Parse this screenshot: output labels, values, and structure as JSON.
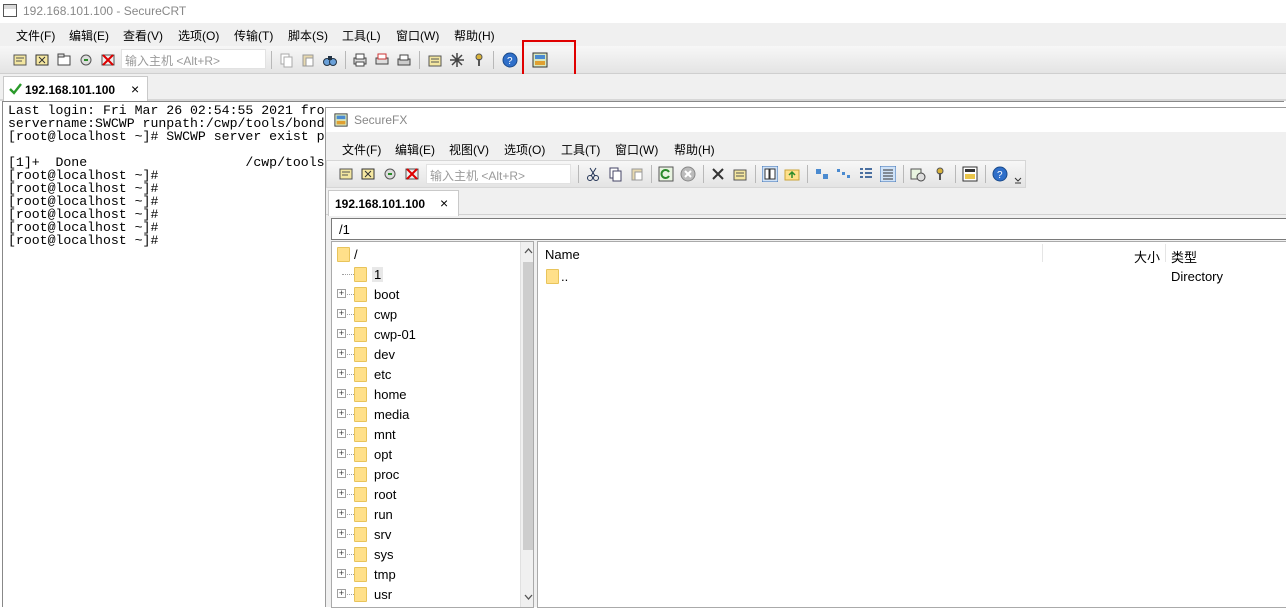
{
  "crt": {
    "title": "192.168.101.100 - SecureCRT",
    "menu": [
      "文件(F)",
      "编辑(E)",
      "查看(V)",
      "选项(O)",
      "传输(T)",
      "脚本(S)",
      "工具(L)",
      "窗口(W)",
      "帮助(H)"
    ],
    "host_placeholder": "输入主机 <Alt+R>",
    "tab_label": "192.168.101.100",
    "tab_close": "×",
    "terminal_lines": [
      "Last login: Fri Mar 26 02:54:55 2021 fro",
      "servername:SWCWP runpath:/cwp/tools/bond",
      "[root@localhost ~]# SWCWP server exist p",
      "",
      "[1]+  Done                    /cwp/tools",
      "[root@localhost ~]#",
      "[root@localhost ~]#",
      "[root@localhost ~]#",
      "[root@localhost ~]#",
      "[root@localhost ~]#",
      "[root@localhost ~]#"
    ]
  },
  "fx": {
    "title": "SecureFX",
    "menu": [
      "文件(F)",
      "编辑(E)",
      "视图(V)",
      "选项(O)",
      "工具(T)",
      "窗口(W)",
      "帮助(H)"
    ],
    "host_placeholder": "输入主机 <Alt+R>",
    "tab_label": "192.168.101.100",
    "tab_close": "×",
    "path": "/1",
    "tree": [
      "/",
      "1",
      "boot",
      "cwp",
      "cwp-01",
      "dev",
      "etc",
      "home",
      "media",
      "mnt",
      "opt",
      "proc",
      "root",
      "run",
      "srv",
      "sys",
      "tmp",
      "usr"
    ],
    "columns": {
      "name": "Name",
      "size": "大小",
      "type": "类型"
    },
    "rows": [
      {
        "name": "..",
        "type": "Directory"
      }
    ]
  },
  "colors": {
    "highlight": "#e00000",
    "folder": "#ffe08a"
  }
}
